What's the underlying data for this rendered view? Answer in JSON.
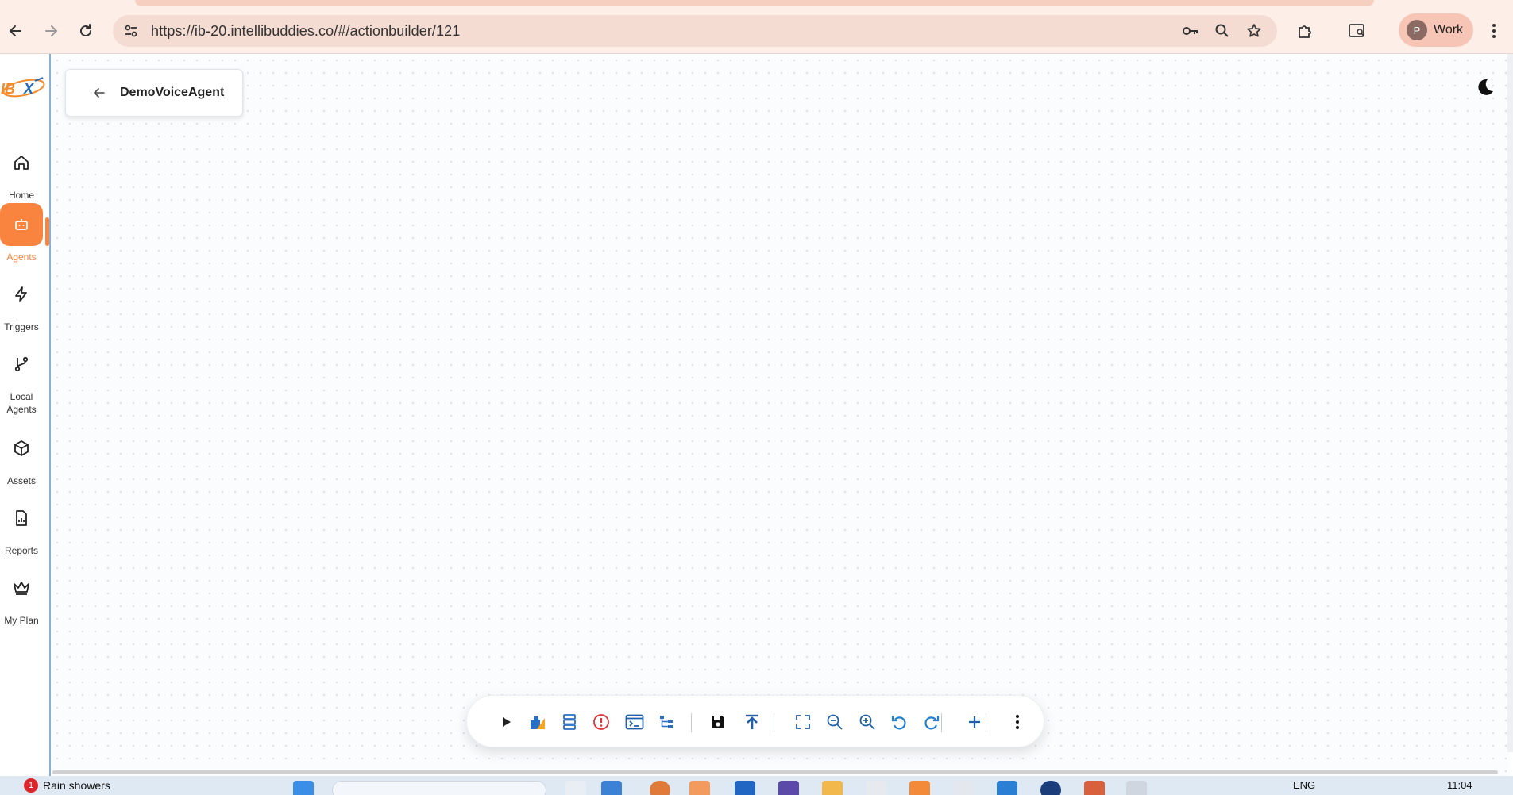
{
  "browser": {
    "url": "https://ib-20.intellibuddies.co/#/actionbuilder/121",
    "profile_initial": "P",
    "profile_label": "Work"
  },
  "app": {
    "agent_title": "DemoVoiceAgent",
    "accent_color": "#f9843f"
  },
  "sidebar": {
    "items": [
      {
        "label": "Home",
        "icon": "home-icon"
      },
      {
        "label": "Agents",
        "icon": "robot-icon",
        "active": true
      },
      {
        "label": "Triggers",
        "icon": "lightning-icon"
      },
      {
        "label": "Local\nAgents",
        "icon": "branch-icon"
      },
      {
        "label": "Assets",
        "icon": "cube-icon"
      },
      {
        "label": "Reports",
        "icon": "report-icon"
      },
      {
        "label": "My Plan",
        "icon": "crown-icon"
      }
    ]
  },
  "toolbar": {
    "buttons": [
      "run",
      "variables",
      "database",
      "errors",
      "console",
      "tree",
      "save",
      "publish",
      "fit-view",
      "zoom-out",
      "zoom-in",
      "undo",
      "redo",
      "add",
      "more"
    ]
  },
  "taskbar": {
    "weather_badge": "1",
    "weather_text": "Rain showers",
    "lang": "ENG",
    "time": "11:04"
  }
}
